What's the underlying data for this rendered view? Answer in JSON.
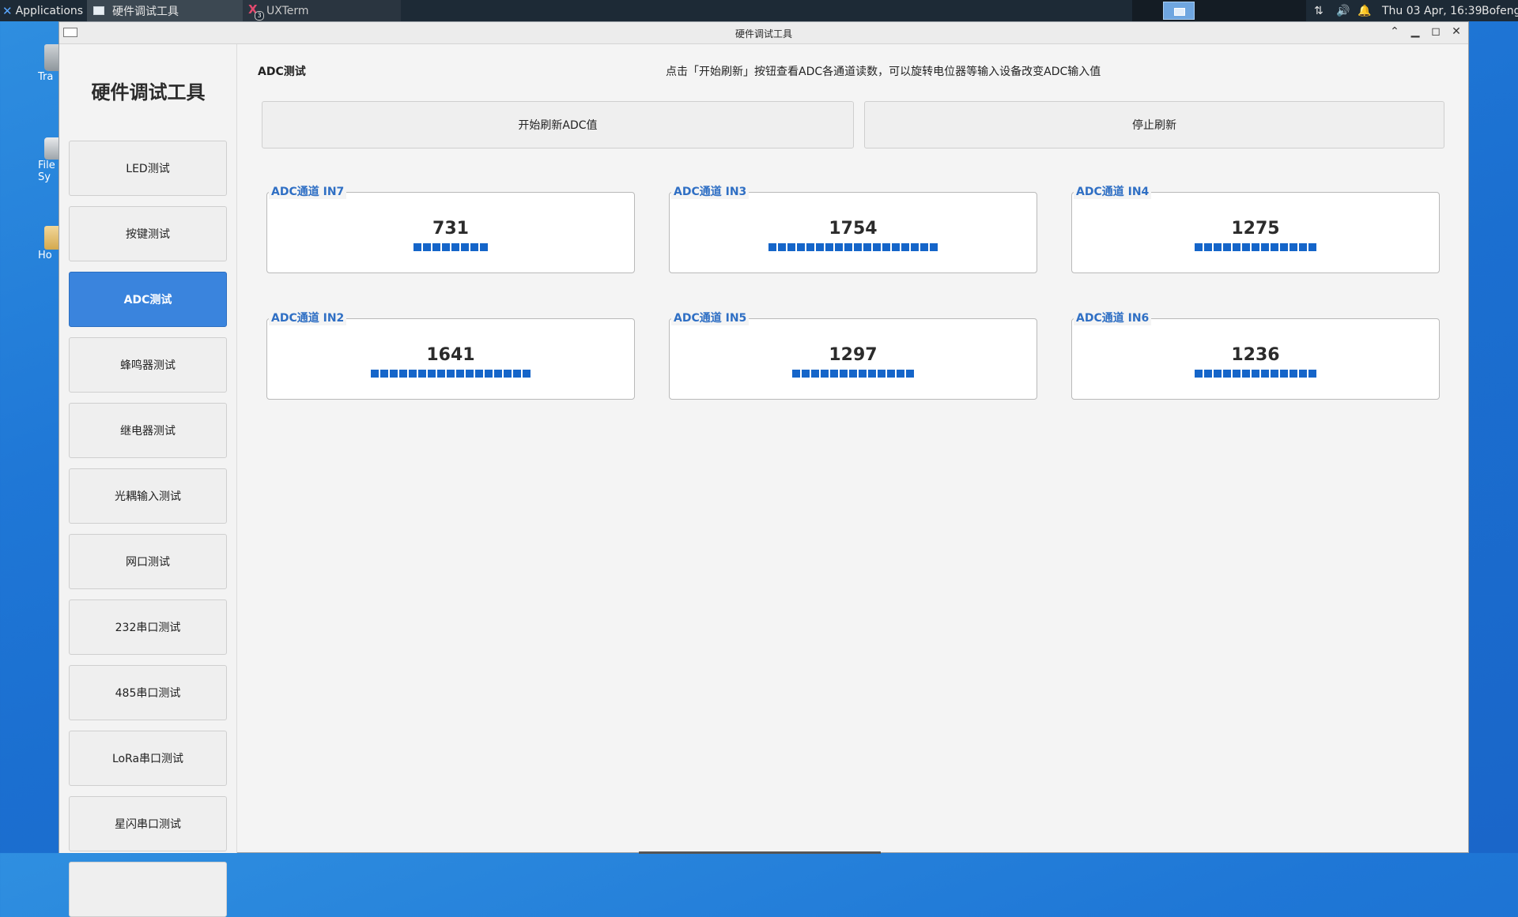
{
  "taskbar": {
    "applications_label": "Applications",
    "task_active": "硬件调试工具",
    "task_inactive": "UXTerm",
    "xterm_badge": "3",
    "datetime": "Thu 03 Apr, 16:39",
    "user": "Bofeng"
  },
  "desktop": {
    "icons": [
      {
        "label": "Tra"
      },
      {
        "label": "File Sy"
      },
      {
        "label": "Ho"
      }
    ]
  },
  "window": {
    "title": "硬件调试工具"
  },
  "sidebar": {
    "app_title": "硬件调试工具",
    "items": [
      {
        "label": "LED测试",
        "active": false
      },
      {
        "label": "按键测试",
        "active": false
      },
      {
        "label": "ADC测试",
        "active": true
      },
      {
        "label": "蜂鸣器测试",
        "active": false
      },
      {
        "label": "继电器测试",
        "active": false
      },
      {
        "label": "光耦输入测试",
        "active": false
      },
      {
        "label": "网口测试",
        "active": false
      },
      {
        "label": "232串口测试",
        "active": false
      },
      {
        "label": "485串口测试",
        "active": false
      },
      {
        "label": "LoRa串口测试",
        "active": false
      },
      {
        "label": "星闪串口测试",
        "active": false
      }
    ]
  },
  "main": {
    "section_title": "ADC测试",
    "hint": "点击「开始刷新」按钮查看ADC各通道读数，可以旋转电位器等输入设备改变ADC输入值",
    "start_button": "开始刷新ADC值",
    "stop_button": "停止刷新",
    "channels": [
      {
        "label": "ADC通道 IN7",
        "value": "731",
        "blocks": 8
      },
      {
        "label": "ADC通道 IN3",
        "value": "1754",
        "blocks": 18
      },
      {
        "label": "ADC通道 IN4",
        "value": "1275",
        "blocks": 13
      },
      {
        "label": "ADC通道 IN2",
        "value": "1641",
        "blocks": 17
      },
      {
        "label": "ADC通道 IN5",
        "value": "1297",
        "blocks": 13
      },
      {
        "label": "ADC通道 IN6",
        "value": "1236",
        "blocks": 13
      }
    ]
  },
  "colors": {
    "accent": "#3a84dd",
    "bar": "#1565c9",
    "legend": "#2f6fc4"
  }
}
